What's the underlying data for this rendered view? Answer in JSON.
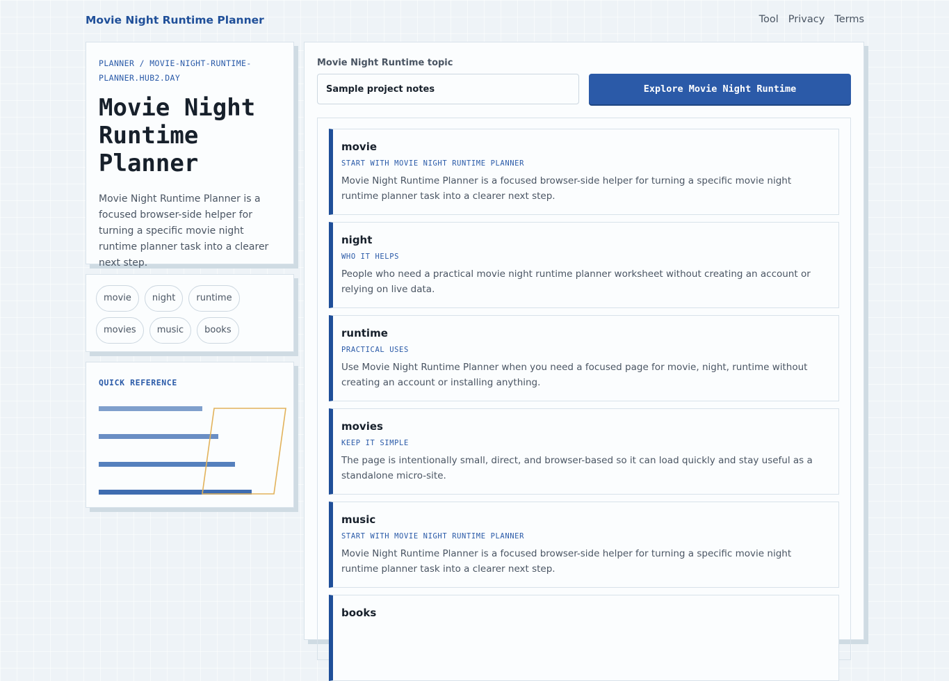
{
  "site": {
    "brand": "Movie Night Runtime Planner",
    "nav": [
      "Tool",
      "Privacy",
      "Terms"
    ]
  },
  "intro": {
    "breadcrumb": "PLANNER / MOVIE-NIGHT-RUNTIME-PLANNER.HUB2.DAY",
    "title": "Movie Night Runtime Planner",
    "description": "Movie Night Runtime Planner is a focused browser-side helper for turning a specific movie night runtime planner task into a clearer next step."
  },
  "tags": [
    "movie",
    "night",
    "runtime",
    "movies",
    "music",
    "books"
  ],
  "quick_reference": {
    "title": "QUICK REFERENCE",
    "bar_colors": [
      "#7f9fcc",
      "#6a8ec4",
      "#5580bd",
      "#3e6cb0"
    ],
    "accent": "#e2b25a"
  },
  "tool": {
    "label": "Movie Night Runtime topic",
    "input_value": "Sample project notes",
    "button_label": "Explore Movie Night Runtime"
  },
  "results": [
    {
      "title": "movie",
      "tag": "START WITH MOVIE NIGHT RUNTIME PLANNER",
      "body": "Movie Night Runtime Planner is a focused browser-side helper for turning a specific movie night runtime planner task into a clearer next step."
    },
    {
      "title": "night",
      "tag": "WHO IT HELPS",
      "body": "People who need a practical movie night runtime planner worksheet without creating an account or relying on live data."
    },
    {
      "title": "runtime",
      "tag": "PRACTICAL USES",
      "body": "Use Movie Night Runtime Planner when you need a focused page for movie, night, runtime without creating an account or installing anything."
    },
    {
      "title": "movies",
      "tag": "KEEP IT SIMPLE",
      "body": "The page is intentionally small, direct, and browser-based so it can load quickly and stay useful as a standalone micro-site."
    },
    {
      "title": "music",
      "tag": "START WITH MOVIE NIGHT RUNTIME PLANNER",
      "body": "Movie Night Runtime Planner is a focused browser-side helper for turning a specific movie night runtime planner task into a clearer next step."
    },
    {
      "title": "books",
      "tag": "",
      "body": ""
    }
  ]
}
